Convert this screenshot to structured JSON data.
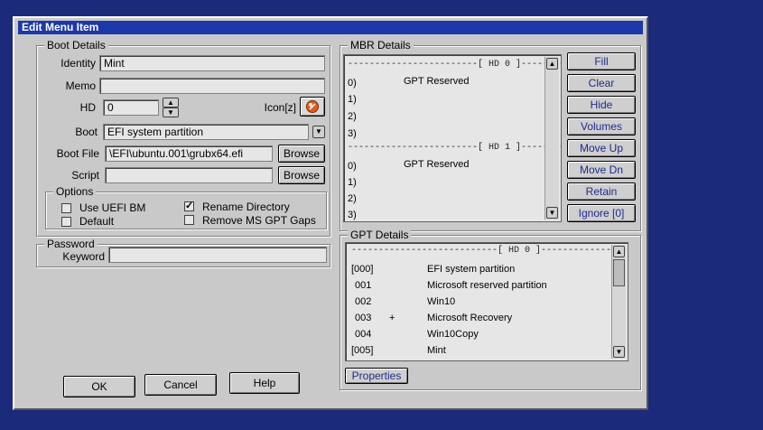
{
  "window": {
    "title": "Edit Menu Item"
  },
  "boot_details": {
    "legend": "Boot Details",
    "identity_label": "Identity",
    "identity_value": "Mint",
    "memo_label": "Memo",
    "memo_value": "",
    "hd_label": "HD",
    "hd_value": "0",
    "icon_label": "Icon[z]",
    "boot_label": "Boot",
    "boot_value": "EFI system partition",
    "bootfile_label": "Boot File",
    "bootfile_value": "\\EFI\\ubuntu.001\\grubx64.efi",
    "script_label": "Script",
    "script_value": "",
    "browse_label": "Browse",
    "options": {
      "legend": "Options",
      "use_uefi_bm": {
        "label": "Use UEFI BM",
        "checked": false
      },
      "default": {
        "label": "Default",
        "checked": false
      },
      "rename_directory": {
        "label": "Rename Directory",
        "checked": true
      },
      "remove_ms_gpt": {
        "label": "Remove MS GPT Gaps",
        "checked": false
      }
    }
  },
  "password": {
    "legend": "Password",
    "keyword_label": "Keyword",
    "keyword_value": ""
  },
  "mbr_details": {
    "legend": "MBR Details",
    "hd0_header": "------------------------[ HD 0 ]--------------------",
    "hd1_header": "------------------------[ HD 1 ]--------------------",
    "hd0_rows": [
      {
        "num": "0)",
        "text": "GPT Reserved"
      },
      {
        "num": "1)",
        "text": ""
      },
      {
        "num": "2)",
        "text": ""
      },
      {
        "num": "3)",
        "text": ""
      }
    ],
    "hd1_rows": [
      {
        "num": "0)",
        "text": "GPT Reserved"
      },
      {
        "num": "1)",
        "text": ""
      },
      {
        "num": "2)",
        "text": ""
      },
      {
        "num": "3)",
        "text": ""
      }
    ]
  },
  "side_buttons": {
    "fill": "Fill",
    "clear": "Clear",
    "hide": "Hide",
    "volumes": "Volumes",
    "move_up": "Move Up",
    "move_dn": "Move Dn",
    "retain": "Retain",
    "ignore": "Ignore [0]"
  },
  "gpt_details": {
    "legend": "GPT Details",
    "header": "---------------------------[ HD 0 ]----------------------------",
    "rows": [
      {
        "num": "[000]",
        "mark": "",
        "text": "EFI system partition"
      },
      {
        "num": "001",
        "mark": "",
        "text": "Microsoft reserved partition"
      },
      {
        "num": "002",
        "mark": "",
        "text": "Win10"
      },
      {
        "num": "003",
        "mark": "+",
        "text": "Microsoft Recovery"
      },
      {
        "num": "004",
        "mark": "",
        "text": "Win10Copy"
      },
      {
        "num": "[005]",
        "mark": "",
        "text": "Mint"
      }
    ],
    "properties_label": "Properties"
  },
  "footer": {
    "ok": "OK",
    "cancel": "Cancel",
    "help": "Help"
  }
}
